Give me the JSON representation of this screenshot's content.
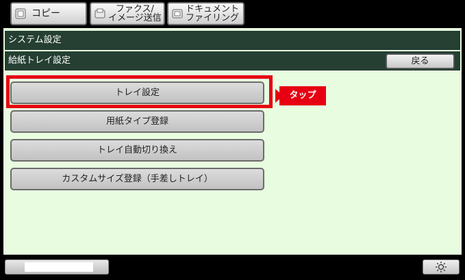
{
  "tabs": [
    {
      "label": "コピー",
      "icon": "copy-icon"
    },
    {
      "label": "ファクス/\nイメージ送信",
      "icon": "fax-icon"
    },
    {
      "label": "ドキュメント\nファイリング",
      "icon": "document-filing-icon"
    }
  ],
  "header": {
    "system_title": "システム設定",
    "page_title": "給紙トレイ設定",
    "back_label": "戻る"
  },
  "menu": {
    "tray_settings": "トレイ設定",
    "paper_type_registration": "用紙タイプ登録",
    "auto_tray_switching": "トレイ自動切り換え",
    "custom_size_registration": "カスタムサイズ登録（手差しトレイ）"
  },
  "callout": {
    "label": "タップ"
  },
  "footer": {
    "brightness_icon": "brightness-icon"
  },
  "colors": {
    "background": "#e8fde0",
    "header_bar": "#253f33",
    "highlight": "#e60012"
  }
}
